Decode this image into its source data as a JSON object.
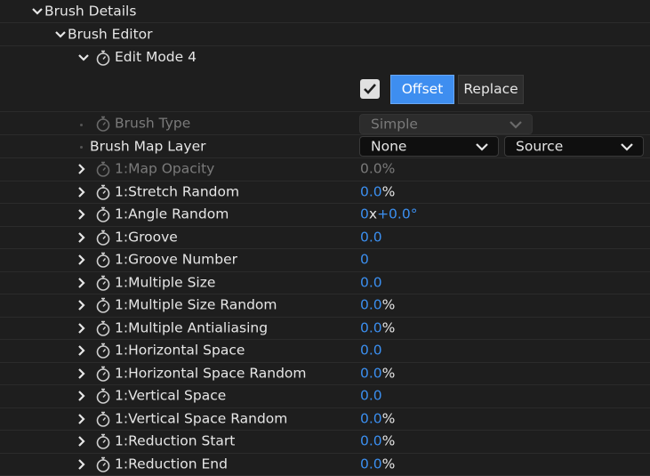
{
  "tree": {
    "brush_details_label": "Brush Details",
    "brush_editor_label": "Brush Editor",
    "edit_mode_label": "Edit Mode 4"
  },
  "mode_buttons": {
    "offset_label": "Offset",
    "replace_label": "Replace",
    "checkbox_checked": true
  },
  "brush_type": {
    "label": "Brush Type",
    "value": "Simple"
  },
  "brush_map_layer": {
    "label": "Brush Map Layer",
    "layer_value": "None",
    "source_value": "Source"
  },
  "properties": [
    {
      "label": "1:Map Opacity",
      "value": "0.0",
      "unit": "%",
      "disabled": true
    },
    {
      "label": "1:Stretch Random",
      "value": "0.0",
      "unit": "%"
    },
    {
      "label": "1:Angle Random",
      "value": "0",
      "mid": "x",
      "value2": "+0.0°"
    },
    {
      "label": "1:Groove",
      "value": "0.0"
    },
    {
      "label": "1:Groove Number",
      "value": "0"
    },
    {
      "label": "1:Multiple Size",
      "value": "0.0"
    },
    {
      "label": "1:Multiple Size Random",
      "value": "0.0",
      "unit": "%"
    },
    {
      "label": "1:Multiple Antialiasing",
      "value": "0.0",
      "unit": "%"
    },
    {
      "label": "1:Horizontal Space",
      "value": "0.0"
    },
    {
      "label": "1:Horizontal Space Random",
      "value": "0.0",
      "unit": "%"
    },
    {
      "label": "1:Vertical Space",
      "value": "0.0"
    },
    {
      "label": "1:Vertical Space Random",
      "value": "0.0",
      "unit": "%"
    },
    {
      "label": "1:Reduction Start",
      "value": "0.0",
      "unit": "%"
    },
    {
      "label": "1:Reduction End",
      "value": "0.0",
      "unit": "%"
    }
  ],
  "colors": {
    "background": "#1e1e1e",
    "accent": "#3b8ff0",
    "offset_button": "#3e8ef0",
    "text": "#e6e6e6",
    "disabled_text": "#7a7a7a"
  },
  "icons": {
    "expand": "chevron-down-icon",
    "collapse": "chevron-right-icon",
    "stopwatch": "stopwatch-icon",
    "checkbox": "checkmark-icon",
    "dropdown": "chevron-down-icon"
  }
}
